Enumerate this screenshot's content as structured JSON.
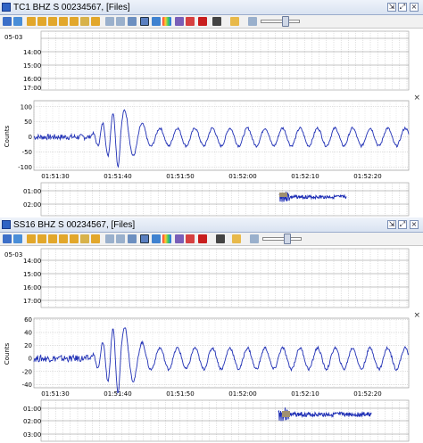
{
  "panels": [
    {
      "title": "TC1 BHZ S 00234567, [Files]",
      "heli": {
        "date": "05-03",
        "times": [
          "14:00",
          "15:00",
          "16:00",
          "17:00"
        ]
      },
      "trace": {
        "ylabel": "Counts",
        "yticks": [
          100,
          50,
          0,
          -50,
          -100
        ],
        "ylim": [
          -110,
          120
        ],
        "xticks": [
          "01:51:30",
          "01:51:40",
          "01:51:50",
          "01:52:00",
          "01:52:10",
          "01:52:20"
        ]
      },
      "bottom": {
        "times": [
          "01:00",
          "02:00"
        ]
      }
    },
    {
      "title": "SS16 BHZ S 00234567, [Files]",
      "heli": {
        "date": "05-03",
        "times": [
          "14:00",
          "15:00",
          "16:00",
          "17:00"
        ]
      },
      "trace": {
        "ylabel": "Counts",
        "yticks": [
          60,
          40,
          20,
          0,
          -20,
          -40
        ],
        "ylim": [
          -45,
          62
        ],
        "xticks": [
          "01:51:30",
          "01:51:40",
          "01:51:50",
          "01:52:00",
          "01:52:10",
          "01:52:20"
        ]
      },
      "bottom": {
        "times": [
          "01:00",
          "02:00",
          "03:00"
        ]
      }
    }
  ],
  "window_buttons": {
    "dock": "⇲",
    "max": "⤢",
    "close": "×"
  },
  "colors": {
    "trace": "#1f2fb5",
    "grid": "#b7b7b7",
    "titlebar": "#dbe4f2"
  },
  "chart_data": [
    {
      "type": "line",
      "title": "",
      "ylabel": "Counts",
      "x": [
        "01:51:30",
        "01:51:40",
        "01:51:50",
        "01:52:00",
        "01:52:10",
        "01:52:20"
      ],
      "ylim": [
        -110,
        120
      ],
      "series": [
        {
          "values": [
            0,
            -100,
            50,
            -40,
            30,
            -20
          ]
        }
      ]
    },
    {
      "type": "line",
      "title": "",
      "ylabel": "Counts",
      "x": [
        "01:51:30",
        "01:51:40",
        "01:51:50",
        "01:52:00",
        "01:52:10",
        "01:52:20"
      ],
      "ylim": [
        -45,
        62
      ],
      "series": [
        {
          "values": [
            0,
            60,
            -30,
            20,
            -10,
            5
          ]
        }
      ]
    }
  ]
}
